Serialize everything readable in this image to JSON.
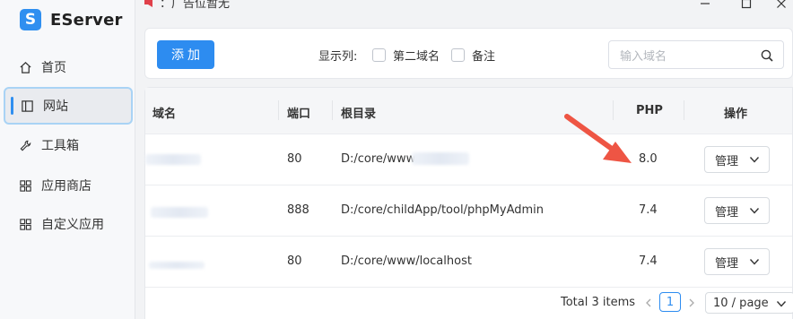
{
  "app": {
    "logo_letter": "S",
    "name": "EServer"
  },
  "window": {
    "notice": "：广告位暂无"
  },
  "sidebar": {
    "items": [
      {
        "label": "首页",
        "icon": "home-icon"
      },
      {
        "label": "网站",
        "icon": "website-icon",
        "active": true
      },
      {
        "label": "工具箱",
        "icon": "wrench-icon"
      },
      {
        "label": "应用商店",
        "icon": "app-grid-icon"
      },
      {
        "label": "自定义应用",
        "icon": "app-grid-icon"
      }
    ]
  },
  "toolbar": {
    "add_label": "添加",
    "columns_label": "显示列:",
    "columns": [
      {
        "label": "第二域名",
        "checked": false
      },
      {
        "label": "备注",
        "checked": false
      }
    ],
    "search_placeholder": "输入域名"
  },
  "table": {
    "headers": {
      "domain": "域名",
      "port": "端口",
      "root": "根目录",
      "php": "PHP",
      "actions": "操作"
    },
    "rows": [
      {
        "domain": "",
        "port": "80",
        "root": "D:/core/www",
        "php": "8.0",
        "action": "管理"
      },
      {
        "domain": "",
        "port": "888",
        "root": "D:/core/childApp/tool/phpMyAdmin",
        "php": "7.4",
        "action": "管理"
      },
      {
        "domain": "",
        "port": "80",
        "root": "D:/core/www/localhost",
        "php": "7.4",
        "action": "管理"
      }
    ]
  },
  "pagination": {
    "total_text": "Total 3 items",
    "current_page": "1",
    "page_size": "10 / page"
  },
  "colors": {
    "accent": "#2d8cf0",
    "annotation_arrow": "#ee5544"
  }
}
